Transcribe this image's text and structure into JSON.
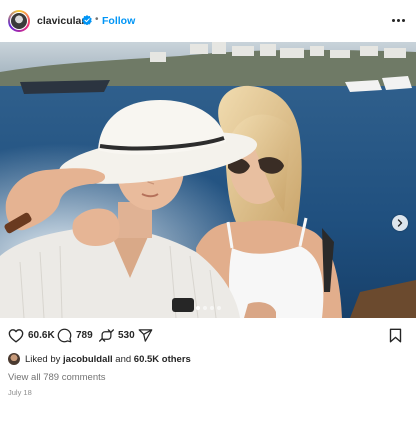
{
  "post": {
    "username": "clavicular0",
    "separator": "•",
    "follow_label": "Follow",
    "more_icon": "more-horizontal-icon",
    "verified_icon": "verified-badge-icon"
  },
  "media": {
    "carousel_count": 4,
    "active_index": 1,
    "next_icon": "chevron-right-icon"
  },
  "actions": {
    "likes": "60.6K",
    "comments": "789",
    "reposts": "530",
    "icons": [
      "heart-icon",
      "comment-icon",
      "repost-icon",
      "share-icon",
      "bookmark-icon"
    ]
  },
  "liked_by": {
    "prefix": "Liked by ",
    "user": "jacobuldall",
    "suffix": " and ",
    "others": "60.5K others"
  },
  "view_comments": "View all 789 comments",
  "date": "July 18",
  "colors": {
    "link_blue": "#0095f6",
    "text": "#262626",
    "muted": "#737373"
  }
}
